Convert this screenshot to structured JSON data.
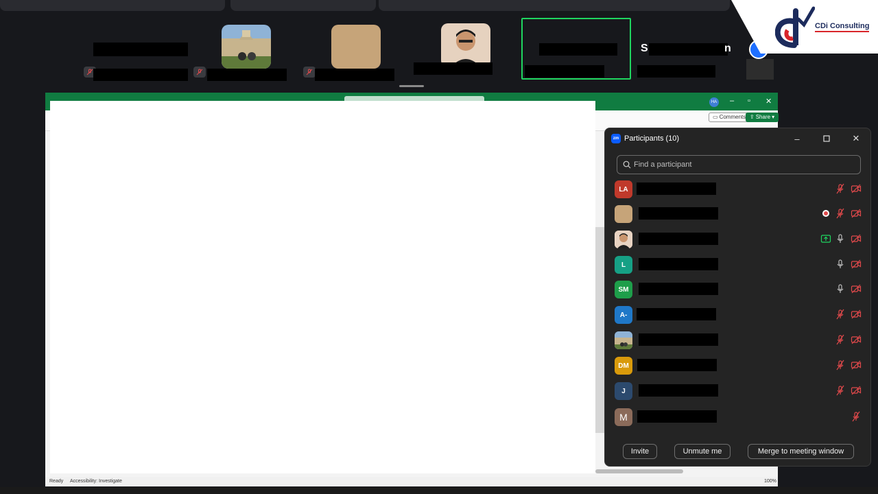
{
  "panel": {
    "title": "Participants (10)",
    "search_placeholder": "Find a participant",
    "participants": [
      {
        "initials": "LA",
        "avatar_color": "#c0392b"
      },
      {
        "initials": "",
        "avatar_color": "#c6a479"
      },
      {
        "initials": "",
        "avatar_color": "#e8d3c2"
      },
      {
        "initials": "L",
        "avatar_color": "#16a085"
      },
      {
        "initials": "SM",
        "avatar_color": "#1e9e4a"
      },
      {
        "initials": "A-",
        "avatar_color": "#1f78c8"
      },
      {
        "initials": "",
        "avatar_color": "#6d8aa8"
      },
      {
        "initials": "DM",
        "avatar_color": "#d99a0b"
      },
      {
        "initials": "J",
        "avatar_color": "#2c4a6e"
      },
      {
        "initials": "M",
        "avatar_color": "#8b6b5a"
      }
    ],
    "buttons": {
      "invite": "Invite",
      "unmute": "Unmute me",
      "merge": "Merge to meeting window"
    }
  },
  "excel": {
    "comments_label": "Comments",
    "share_label": "Share",
    "avatar_initials": "HA",
    "status_ready": "Ready",
    "status_accessibility": "Accessibility: Investigate",
    "zoom": "100%"
  },
  "gallery": {
    "initial_1": "S",
    "initial_2": "n"
  },
  "logo": {
    "text": "CDi Consulting",
    "colors": {
      "navy": "#1c2b5c",
      "red": "#d9252a"
    }
  },
  "colors": {
    "active_speaker": "#1fd660",
    "excel_green": "#107c41",
    "muted_red": "#e0494b",
    "share_green": "#1fd660"
  }
}
